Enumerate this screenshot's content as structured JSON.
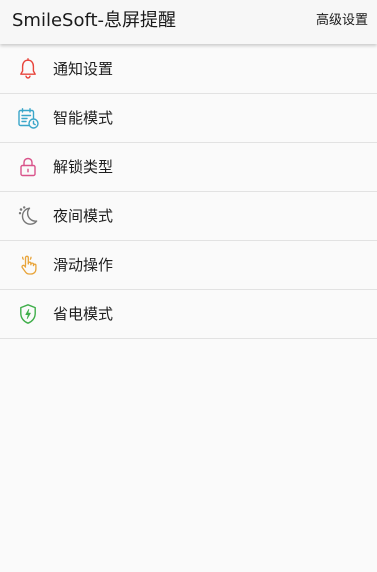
{
  "header": {
    "title": "SmileSoft-息屏提醒",
    "action_label": "高级设置"
  },
  "menu": {
    "items": [
      {
        "label": "通知设置",
        "icon": "bell-icon",
        "color": "#e8453c"
      },
      {
        "label": "智能模式",
        "icon": "calendar-clock-icon",
        "color": "#3aa6c9"
      },
      {
        "label": "解锁类型",
        "icon": "lock-icon",
        "color": "#d9538a"
      },
      {
        "label": "夜间模式",
        "icon": "moon-icon",
        "color": "#777777"
      },
      {
        "label": "滑动操作",
        "icon": "hand-pointer-icon",
        "color": "#e8a43a"
      },
      {
        "label": "省电模式",
        "icon": "battery-shield-icon",
        "color": "#3fae4a"
      }
    ]
  }
}
